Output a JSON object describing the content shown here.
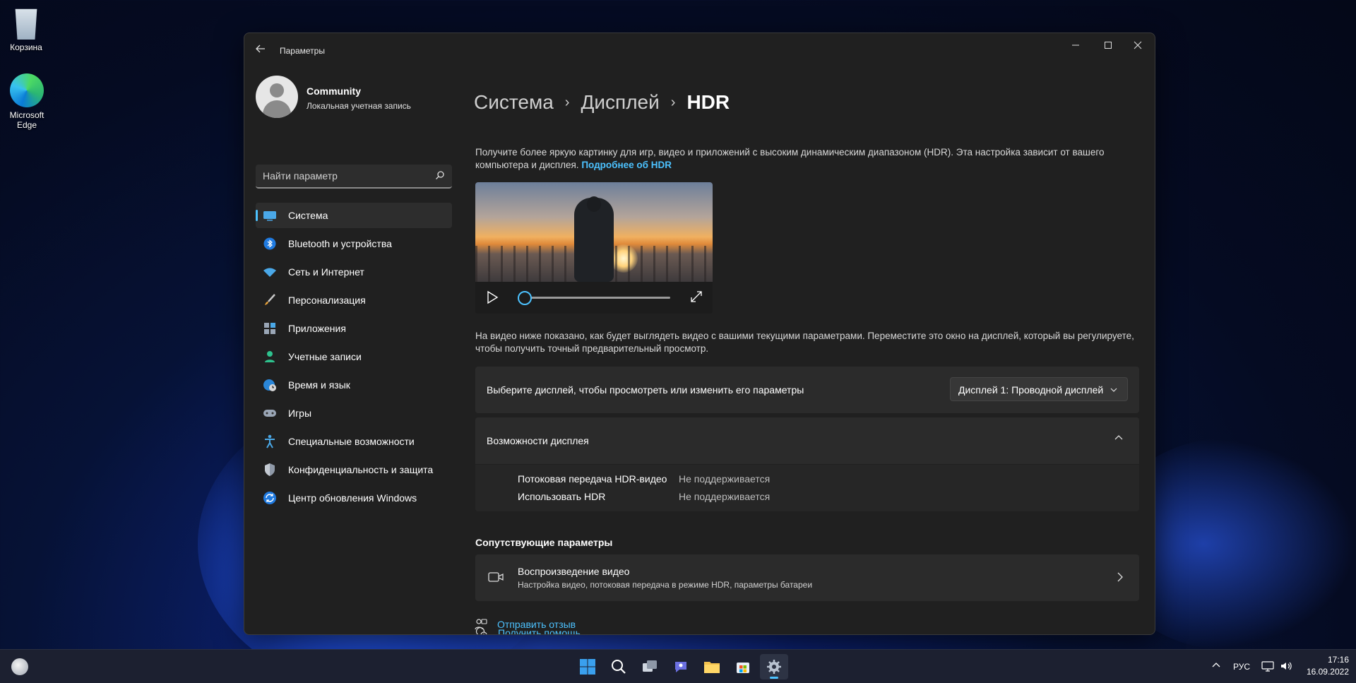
{
  "desktop": {
    "icons": [
      {
        "label": "Корзина"
      },
      {
        "label": "Microsoft Edge"
      }
    ]
  },
  "window": {
    "title": "Параметры",
    "controls": {
      "minimize": "–",
      "maximize": "□",
      "close": "✕"
    }
  },
  "profile": {
    "name": "Community",
    "subtitle": "Локальная учетная запись"
  },
  "search": {
    "placeholder": "Найти параметр"
  },
  "nav": {
    "items": [
      {
        "label": "Система",
        "icon": "display-icon",
        "active": true
      },
      {
        "label": "Bluetooth и устройства",
        "icon": "bluetooth-icon"
      },
      {
        "label": "Сеть и Интернет",
        "icon": "wifi-icon"
      },
      {
        "label": "Персонализация",
        "icon": "brush-icon"
      },
      {
        "label": "Приложения",
        "icon": "apps-icon"
      },
      {
        "label": "Учетные записи",
        "icon": "person-icon"
      },
      {
        "label": "Время и язык",
        "icon": "globe-clock-icon"
      },
      {
        "label": "Игры",
        "icon": "gamepad-icon"
      },
      {
        "label": "Специальные возможности",
        "icon": "accessibility-icon"
      },
      {
        "label": "Конфиденциальность и защита",
        "icon": "shield-icon"
      },
      {
        "label": "Центр обновления Windows",
        "icon": "update-icon"
      }
    ]
  },
  "breadcrumb": {
    "items": [
      "Система",
      "Дисплей"
    ],
    "current": "HDR",
    "separator": "›"
  },
  "main": {
    "description": "Получите более яркую картинку для игр, видео и приложений с высоким динамическим диапазоном (HDR). Эта настройка зависит от вашего компьютера и дисплея.",
    "learn_more": "Подробнее об HDR",
    "video_note": "На видео ниже показано, как будет выглядеть видео с вашими текущими параметрами. Переместите это окно на дисплей, который вы регулируете, чтобы получить точный предварительный просмотр.",
    "video_progress": 0,
    "display_select": {
      "label": "Выберите дисплей, чтобы просмотреть или изменить его параметры",
      "value": "Дисплей 1: Проводной дисплей"
    },
    "capabilities": {
      "title": "Возможности дисплея",
      "rows": [
        {
          "name": "Потоковая передача HDR-видео",
          "value": "Не поддерживается"
        },
        {
          "name": "Использовать HDR",
          "value": "Не поддерживается"
        }
      ]
    },
    "related": {
      "title": "Сопутствующие параметры",
      "item_title": "Воспроизведение видео",
      "item_subtitle": "Настройка видео, потоковая передача в режиме HDR, параметры батареи"
    },
    "links": {
      "help": "Получить помощь",
      "feedback": "Отправить отзыв"
    }
  },
  "taskbar": {
    "language": "РУС",
    "time": "17:16",
    "date": "16.09.2022"
  },
  "colors": {
    "accent": "#4cc2ff",
    "window_bg": "#202020",
    "card_bg": "#2b2b2b"
  }
}
